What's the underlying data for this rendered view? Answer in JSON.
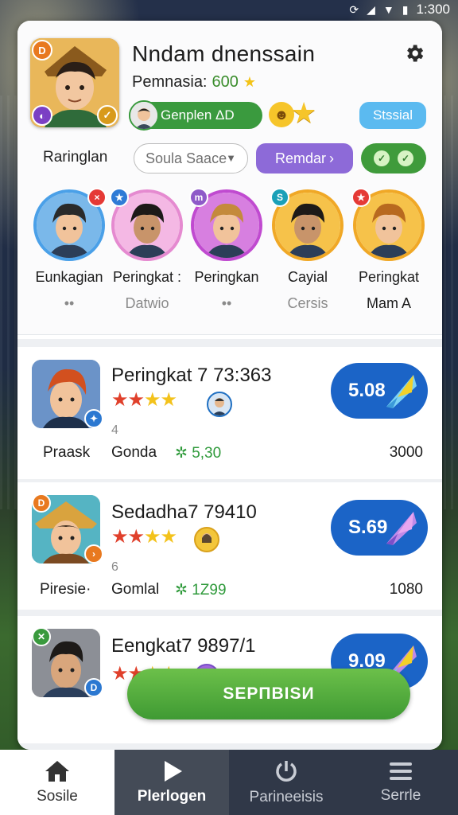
{
  "statusbar": {
    "time": "1:300"
  },
  "profile": {
    "title": "Nndam dnenssain",
    "points_label": "Pemnasia:",
    "points_value": "600",
    "badge_top": "D",
    "tag_label": "Genplen ΔD",
    "side_button": "Stssial"
  },
  "filters": {
    "label": "Raringlan",
    "select_value": "Soula Saace",
    "purple_button": "Remdar",
    "colors": {
      "green": "#3f9b3b",
      "purple": "#8d6ad8",
      "blue": "#5bbaf0"
    }
  },
  "players": [
    {
      "name": "Eunkagian",
      "sub": "••",
      "ring": "#4aa0e8",
      "mark_color": "#e53935",
      "mark": "×",
      "mark_side": "tr"
    },
    {
      "name": "Peringkat :",
      "sub": "Datwio",
      "ring": "#e58ad0",
      "mark_color": "#2e7bd6",
      "mark": "★",
      "mark_side": "tl"
    },
    {
      "name": "Peringkan",
      "sub": "••",
      "ring": "#c04ad0",
      "mark_color": "#8e5ac8",
      "mark": "m",
      "mark_side": "tl"
    },
    {
      "name": "Cayial",
      "sub": "Cersis",
      "ring": "#f0a826",
      "mark_color": "#1aa0b8",
      "mark": "S",
      "mark_side": "tl"
    },
    {
      "name": "Peringkat",
      "sub": "Mam A",
      "ring": "#f0a826",
      "mark_color": "#e53935",
      "mark": "★",
      "mark_side": "tl"
    }
  ],
  "rows": [
    {
      "title": "Peringkat 7 73:363",
      "rating": 3,
      "small": "4",
      "left": "Praask",
      "mid": "Gonda",
      "delta": "5,30",
      "right": "3000",
      "score": "5.08"
    },
    {
      "title": "Sedadha7 79410",
      "rating": 3,
      "small": "6",
      "left": "Piresie·",
      "mid": "Gomlal",
      "delta": "1Z99",
      "right": "1080",
      "score": "S.69"
    },
    {
      "title": "Eengkat7 9897/1",
      "rating": 3,
      "small": "",
      "left": "",
      "mid": "",
      "delta": "",
      "right": "",
      "score": "9.09"
    }
  ],
  "cta": {
    "label": "SEPПBISИ"
  },
  "nav": [
    {
      "label": "Sosile",
      "icon": "home-icon"
    },
    {
      "label": "Plerlogen",
      "icon": "play-icon"
    },
    {
      "label": "Parineeisis",
      "icon": "power-icon"
    },
    {
      "label": "Serrle",
      "icon": "menu-icon"
    }
  ]
}
